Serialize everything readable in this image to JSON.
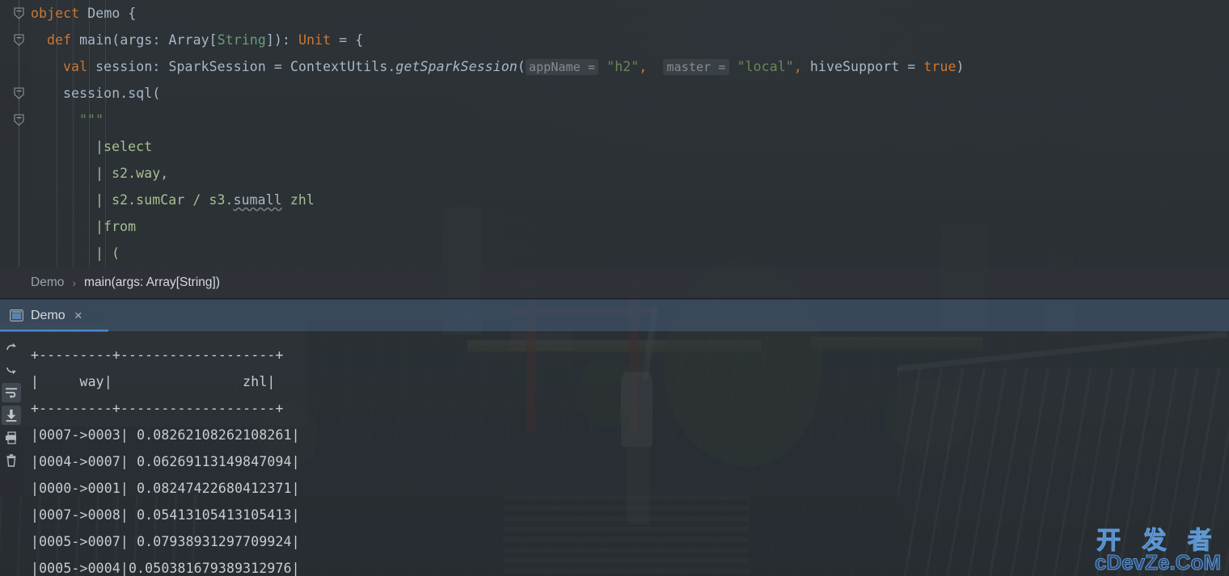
{
  "editor": {
    "lines": [
      {
        "indent": 0,
        "segments": [
          {
            "t": "object ",
            "c": "kw"
          },
          {
            "t": "Demo ",
            "c": "cls"
          },
          {
            "t": "{",
            "c": "punc"
          }
        ]
      },
      {
        "indent": 1,
        "segments": [
          {
            "t": "def ",
            "c": "kw"
          },
          {
            "t": "main",
            "c": "cls"
          },
          {
            "t": "(args: Array[",
            "c": "punc"
          },
          {
            "t": "String",
            "c": "typ"
          },
          {
            "t": "]): ",
            "c": "punc"
          },
          {
            "t": "Unit",
            "c": "kw"
          },
          {
            "t": " = {",
            "c": "punc"
          }
        ]
      },
      {
        "indent": 2,
        "segments": [
          {
            "t": "val ",
            "c": "kw"
          },
          {
            "t": "session: SparkSession = ContextUtils.",
            "c": "punc"
          },
          {
            "t": "getSparkSession",
            "c": "itl"
          },
          {
            "t": "(",
            "c": "punc"
          },
          {
            "t": "appName =",
            "c": "hint"
          },
          {
            "t": " ",
            "c": "punc"
          },
          {
            "t": "\"h2\"",
            "c": "str"
          },
          {
            "t": ",",
            "c": "comma"
          },
          {
            "t": "  ",
            "c": "punc"
          },
          {
            "t": "master =",
            "c": "hint"
          },
          {
            "t": " ",
            "c": "punc"
          },
          {
            "t": "\"local\"",
            "c": "str"
          },
          {
            "t": ",",
            "c": "comma"
          },
          {
            "t": " hiveSupport = ",
            "c": "punc"
          },
          {
            "t": "true",
            "c": "kw"
          },
          {
            "t": ")",
            "c": "punc"
          }
        ]
      },
      {
        "indent": 2,
        "segments": [
          {
            "t": "session.sql(",
            "c": "punc"
          }
        ]
      },
      {
        "indent": 3,
        "segments": [
          {
            "t": "\"\"\"",
            "c": "str"
          }
        ]
      },
      {
        "indent": 4,
        "segments": [
          {
            "t": "|select",
            "c": "sqlk"
          }
        ]
      },
      {
        "indent": 4,
        "segments": [
          {
            "t": "| s2.way,",
            "c": "sqlk"
          }
        ]
      },
      {
        "indent": 4,
        "segments": [
          {
            "t": "| s2.sumCar / s3.",
            "c": "sqlk"
          },
          {
            "t": "sumall",
            "c": "squiggle"
          },
          {
            "t": " zhl",
            "c": "sqlk"
          }
        ]
      },
      {
        "indent": 4,
        "segments": [
          {
            "t": "|from",
            "c": "sqlk"
          }
        ]
      },
      {
        "indent": 4,
        "segments": [
          {
            "t": "| (",
            "c": "sqlk"
          }
        ]
      }
    ]
  },
  "breadcrumb": {
    "items": [
      "Demo",
      "main(args: Array[String])"
    ],
    "separator": "›"
  },
  "toolwindow": {
    "tab": {
      "label": "Demo",
      "close_label": "×",
      "icon": "run-configuration-icon"
    },
    "toolbar": [
      {
        "name": "up-arrow-icon",
        "title": "Up the Stack Trace"
      },
      {
        "name": "down-arrow-icon",
        "title": "Down the Stack Trace"
      },
      {
        "name": "soft-wrap-icon",
        "title": "Soft-Wrap"
      },
      {
        "name": "scroll-to-end-icon",
        "title": "Scroll to End"
      },
      {
        "name": "print-icon",
        "title": "Print"
      },
      {
        "name": "trash-icon",
        "title": "Clear All"
      }
    ],
    "console": {
      "lines": [
        "+---------+-------------------+",
        "|     way|                zhl|",
        "+---------+-------------------+",
        "|0007->0003| 0.08262108262108261|",
        "|0004->0007| 0.06269113149847094|",
        "|0000->0001| 0.08247422680412371|",
        "|0007->0008| 0.05413105413105413|",
        "|0005->0007| 0.07938931297709924|",
        "|0005->0004|0.050381679389312976|"
      ],
      "table": {
        "columns": [
          "way",
          "zhl"
        ],
        "rows": [
          [
            "0007->0003",
            "0.08262108262108261"
          ],
          [
            "0004->0007",
            "0.06269113149847094"
          ],
          [
            "0000->0001",
            "0.08247422680412371"
          ],
          [
            "0007->0008",
            "0.05413105413105413"
          ],
          [
            "0005->0007",
            "0.07938931297709924"
          ],
          [
            "0005->0004",
            "0.050381679389312976"
          ]
        ]
      }
    }
  },
  "watermark": {
    "cn": "开 发 者",
    "en": "cDevZe.CoM"
  },
  "colors": {
    "keyword": "#cc7832",
    "string": "#6a8759",
    "type": "#6a9c78",
    "text": "#a9b7c6",
    "tab_accent": "#4a88c7",
    "tabbar_bg": "#3c4f63",
    "editor_bg": "#2b3034",
    "breadcrumb_bg": "#2e3338"
  }
}
